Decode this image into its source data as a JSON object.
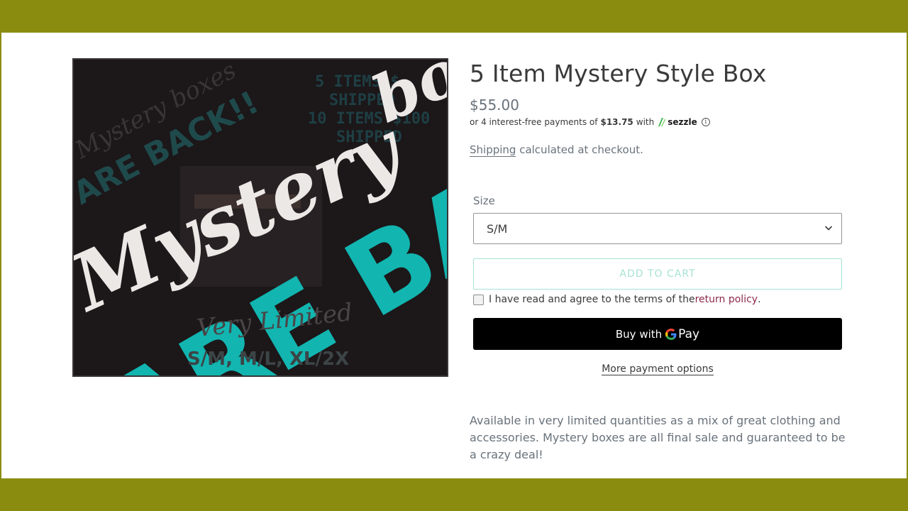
{
  "product": {
    "title": "5 Item Mystery Style Box",
    "price": "$55.00",
    "image": {
      "alt_overlay_texts": [
        "Mystery",
        "bo",
        "Mystery boxes",
        "ARE BACK!!",
        "5 ITEMS $",
        "SHIPPED",
        "10 ITEMS $100",
        "SHIPPED",
        "ARE BA",
        "Very Limited",
        "S/M, M/L, XL/2X"
      ],
      "colors": {
        "background": "#1c1719",
        "teal": "#12b5b0",
        "script": "#ece8e6"
      }
    }
  },
  "sezzle": {
    "prefix": "or 4 interest-free payments of",
    "amount": "$13.75",
    "with": "with",
    "brand": "sezzle",
    "info": "i"
  },
  "shipping": {
    "link": "Shipping",
    "text": " calculated at checkout."
  },
  "size": {
    "label": "Size",
    "selected": "S/M"
  },
  "buttons": {
    "add_to_cart": "ADD TO CART",
    "buy_with": "Buy with",
    "pay": "Pay",
    "more_options": "More payment options"
  },
  "terms": {
    "text": "I have read and agree to the terms of the ",
    "link": "return policy",
    "end": "."
  },
  "description": "Available in very limited quantities as a mix of great clothing and accessories. Mystery boxes are all final sale and guaranteed to be a crazy deal!",
  "colors": {
    "frame": "#8a8c10",
    "accent_teal": "#a8e2d4",
    "link_maroon": "#8d2a4a"
  }
}
